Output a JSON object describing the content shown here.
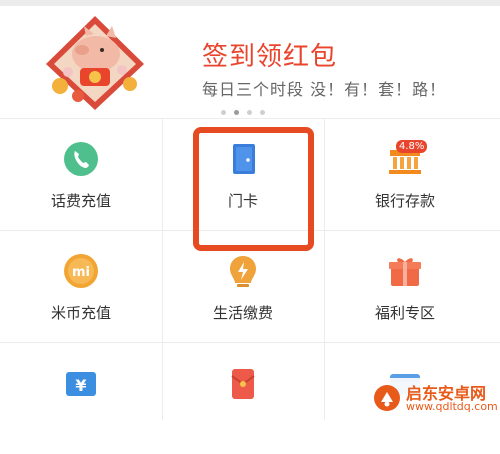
{
  "banner": {
    "title": "签到领红包",
    "subtitle": "每日三个时段 没！有！套！路！",
    "image_icon": "pig-lucky-charm-icon",
    "pager": {
      "total": 4,
      "active_index": 1
    }
  },
  "grid": {
    "items": [
      {
        "label": "话费充值",
        "icon": "phone-icon",
        "color": "#4fc08d"
      },
      {
        "label": "门卡",
        "icon": "door-card-icon",
        "color": "#3b7ddb"
      },
      {
        "label": "银行存款",
        "icon": "bank-icon",
        "color": "#f28a1e",
        "badge": "4.8%"
      },
      {
        "label": "米币充值",
        "icon": "mi-coin-icon",
        "color": "#f3a533"
      },
      {
        "label": "生活缴费",
        "icon": "lightbulb-icon",
        "color": "#f0a23b"
      },
      {
        "label": "福利专区",
        "icon": "gift-icon",
        "color": "#ef6a45"
      },
      {
        "label": "",
        "icon": "yen-card-icon",
        "color": "#3c8fe0"
      },
      {
        "label": "",
        "icon": "red-envelope-icon",
        "color": "#ee5a4a"
      },
      {
        "label": "",
        "icon": "card-icon",
        "color": "#5a9fe6"
      }
    ]
  },
  "highlight": {
    "target": "门卡",
    "color": "#e54a20"
  },
  "watermark": {
    "title": "启东安卓网",
    "url": "www.qdltdq.com",
    "color": "#e85a1a"
  }
}
